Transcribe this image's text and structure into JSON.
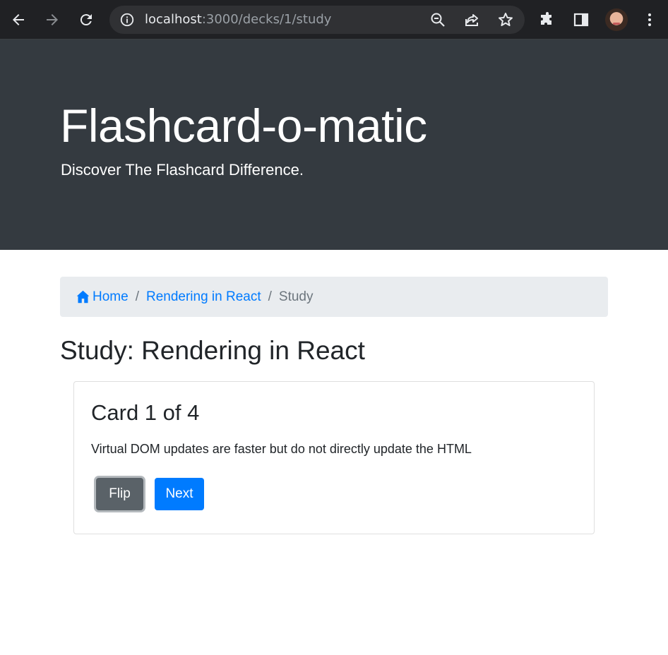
{
  "browser": {
    "url_host": "localhost",
    "url_path": ":3000/decks/1/study",
    "icons": [
      "back-icon",
      "forward-icon",
      "reload-icon",
      "site-info-icon",
      "zoom-out-icon",
      "share-icon",
      "bookmark-star-icon",
      "extensions-icon",
      "side-panel-icon",
      "profile-avatar",
      "menu-icon"
    ]
  },
  "header": {
    "title": "Flashcard-o-matic",
    "subtitle": "Discover The Flashcard Difference."
  },
  "breadcrumb": {
    "home_label": "Home",
    "deck_label": "Rendering in React",
    "separator": "/",
    "current_label": "Study"
  },
  "page": {
    "title": "Study: Rendering in React"
  },
  "card": {
    "title": "Card 1 of 4",
    "text": "Virtual DOM updates are faster but do not directly update the HTML",
    "flip_label": "Flip",
    "next_label": "Next"
  },
  "colors": {
    "jumbotron_bg": "#343a40",
    "link": "#007bff",
    "breadcrumb_bg": "#e9ecef",
    "secondary_button": "#5a6268",
    "primary_button": "#007bff"
  }
}
